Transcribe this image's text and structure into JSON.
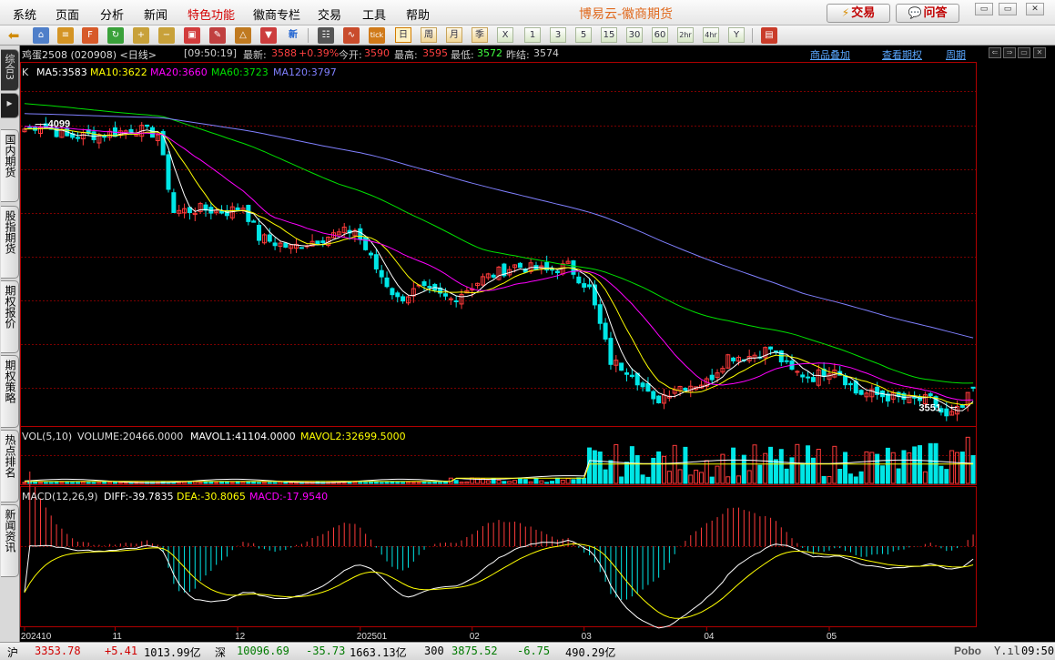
{
  "menu": {
    "items": [
      "系统",
      "页面",
      "分析",
      "新闻",
      "特色功能",
      "徽商专栏",
      "交易",
      "工具",
      "帮助"
    ],
    "brand": "博易云-徽商期货",
    "trade_btn": "交易",
    "ask_btn": "问答",
    "win_min": "▭",
    "win_max": "▭",
    "win_close": "✕"
  },
  "toolbar": {
    "period_labels": [
      "日",
      "周",
      "月",
      "季",
      "X",
      "1",
      "3",
      "5",
      "15",
      "30",
      "60",
      "2hr",
      "4hr",
      "Y"
    ],
    "selected_period": "日",
    "new_label": "新",
    "tick_label": "tick"
  },
  "left_tabs": [
    {
      "label": "综合3"
    },
    {
      "label": "▸"
    },
    {
      "label": "国内期货"
    },
    {
      "label": "股指期货"
    },
    {
      "label": "期权报价"
    },
    {
      "label": "期权策略"
    },
    {
      "label": "热点排名"
    },
    {
      "label": "新闻资讯"
    }
  ],
  "quote": {
    "name": "鸡蛋2508 (020908) <日线>",
    "time": "[09:50:19]",
    "last_label": "最新:",
    "last": "3588",
    "change_pct": "+0.39%",
    "open_label": "今开:",
    "open": "3590",
    "high_label": "最高:",
    "high": "3595",
    "low_label": "最低:",
    "low": "3572",
    "prev_label": "昨结:",
    "prev": "3574"
  },
  "links": {
    "overlay": "商品叠加",
    "options": "查看期权",
    "period": "周期"
  },
  "ma_legend": {
    "k": "K",
    "ma5": "MA5:3583",
    "ma10": "MA10:3622",
    "ma20": "MA20:3660",
    "ma60": "MA60:3723",
    "ma120": "MA120:3797"
  },
  "vol_legend": {
    "vol": "VOL(5,10)",
    "volume": "VOLUME:20466.0000",
    "mavol1": "MAVOL1:41104.0000",
    "mavol2": "MAVOL2:32699.5000"
  },
  "macd_legend": {
    "macd": "MACD(12,26,9)",
    "diff": "DIFF:-39.7835",
    "dea": "DEA:-30.8065",
    "macdv": "MACD:-17.9540"
  },
  "colors": {
    "up": "#ff3b3b",
    "down": "#00e6e6",
    "ma5": "#ffffff",
    "ma10": "#ffff00",
    "ma20": "#ff00ff",
    "ma60": "#00e000",
    "ma120": "#8080ff",
    "grid": "#7a0000",
    "axis": "#b00000"
  },
  "chart_data": {
    "type": "candlestick",
    "title": "鸡蛋2508 (020908) <日线>",
    "price_range": [
      3520,
      4190
    ],
    "annotations": [
      {
        "label": "4099",
        "index": 2,
        "price": 4099
      },
      {
        "label": "3551",
        "index": 175,
        "price": 3551
      }
    ],
    "time_axis": [
      {
        "label": "202410",
        "index": 0
      },
      {
        "label": "11",
        "index": 17
      },
      {
        "label": "12",
        "index": 40
      },
      {
        "label": "202501",
        "index": 63
      },
      {
        "label": "02",
        "index": 84
      },
      {
        "label": "03",
        "index": 105
      },
      {
        "label": "04",
        "index": 128
      },
      {
        "label": "05",
        "index": 151
      }
    ],
    "close_anchors": [
      [
        0,
        4090
      ],
      [
        3,
        4099
      ],
      [
        8,
        4075
      ],
      [
        15,
        4080
      ],
      [
        21,
        4090
      ],
      [
        25,
        4080
      ],
      [
        28,
        3930
      ],
      [
        33,
        3935
      ],
      [
        38,
        3930
      ],
      [
        41,
        3940
      ],
      [
        44,
        3880
      ],
      [
        50,
        3860
      ],
      [
        56,
        3880
      ],
      [
        62,
        3895
      ],
      [
        66,
        3820
      ],
      [
        70,
        3760
      ],
      [
        74,
        3780
      ],
      [
        80,
        3760
      ],
      [
        86,
        3800
      ],
      [
        92,
        3825
      ],
      [
        98,
        3815
      ],
      [
        102,
        3825
      ],
      [
        106,
        3780
      ],
      [
        110,
        3640
      ],
      [
        114,
        3620
      ],
      [
        118,
        3560
      ],
      [
        122,
        3590
      ],
      [
        128,
        3600
      ],
      [
        132,
        3650
      ],
      [
        136,
        3650
      ],
      [
        140,
        3665
      ],
      [
        144,
        3620
      ],
      [
        148,
        3610
      ],
      [
        152,
        3630
      ],
      [
        156,
        3580
      ],
      [
        160,
        3575
      ],
      [
        166,
        3565
      ],
      [
        170,
        3565
      ],
      [
        173,
        3530
      ],
      [
        176,
        3550
      ],
      [
        178,
        3588
      ]
    ],
    "ma_end": {
      "ma5": 3583,
      "ma10": 3622,
      "ma20": 3660,
      "ma60": 3723,
      "ma120": 3797
    },
    "volume": {
      "last": 20466,
      "mavol1": 41104,
      "mavol2": 32699.5
    },
    "macd": {
      "diff": -39.7835,
      "dea": -30.8065,
      "macd": -17.954
    }
  },
  "status": {
    "sh_label": "沪",
    "sh_val": "3353.78",
    "sh_chg": "+5.41",
    "sh_amt": "1013.99亿",
    "sz_label": "深",
    "sz_val": "10096.69",
    "sz_chg": "-35.73",
    "sz_amt": "1663.13亿",
    "i300_label": "300",
    "i300_val": "3875.52",
    "i300_chg": "-6.75",
    "i300_amt": "490.29亿",
    "logo": "Pobo",
    "time": "09:50"
  }
}
